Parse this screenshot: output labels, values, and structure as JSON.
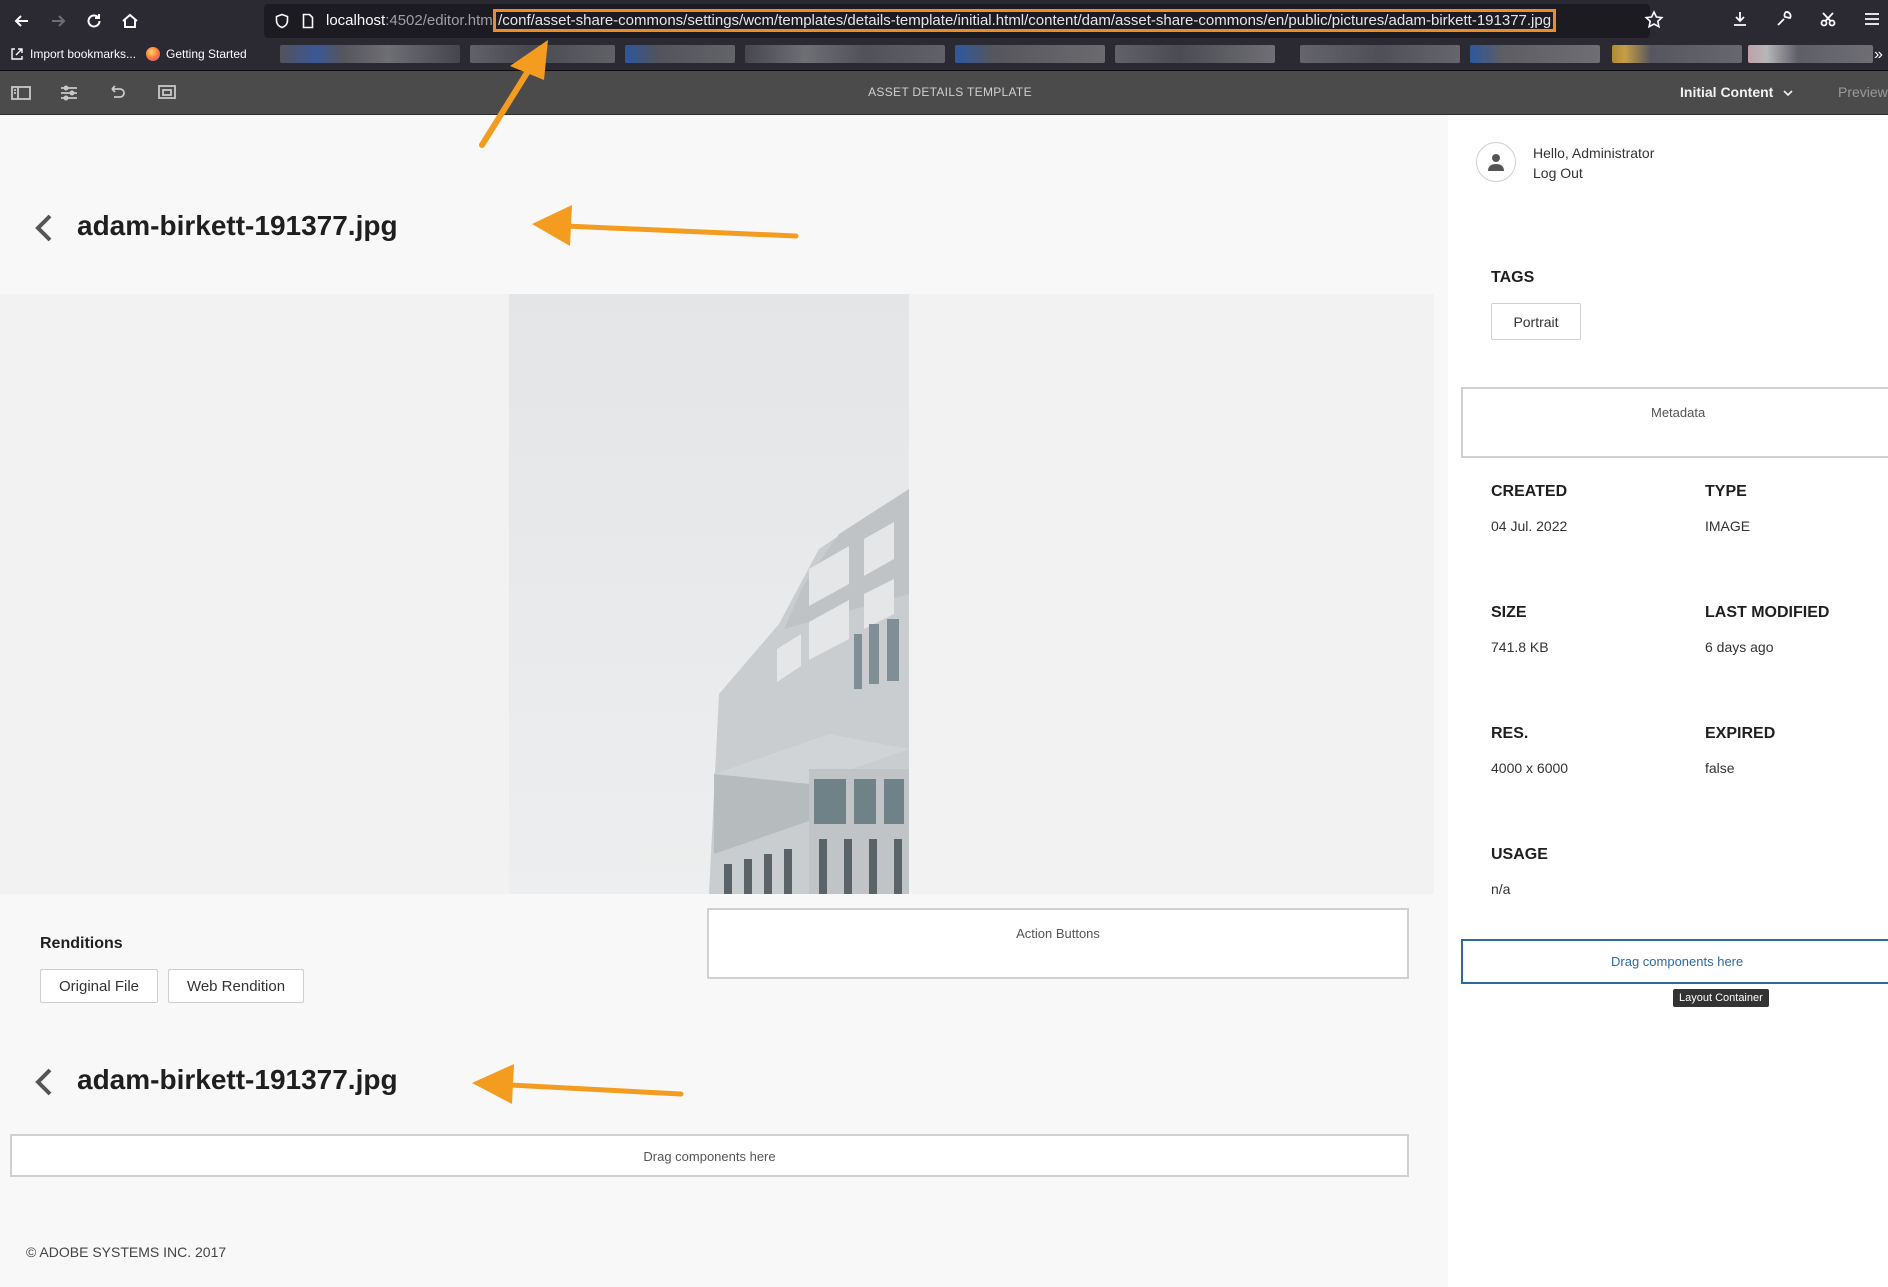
{
  "browser": {
    "url_host": "localhost",
    "url_path_dim": ":4502/editor.html",
    "url_highlighted": "/conf/asset-share-commons/settings/wcm/templates/details-template/initial.html/content/dam/asset-share-commons/en/public/pictures/adam-birkett-191377.jpg",
    "bookmarks": [
      "Import bookmarks...",
      "Getting Started"
    ]
  },
  "editor": {
    "title": "ASSET DETAILS TEMPLATE",
    "mode": "Initial Content",
    "preview": "Preview"
  },
  "page": {
    "title_top": "adam-birkett-191377.jpg",
    "title_bottom": "adam-birkett-191377.jpg",
    "renditions_label": "Renditions",
    "rendition_buttons": [
      "Original File",
      "Web Rendition"
    ],
    "action_buttons_placeholder": "Action Buttons",
    "drag_placeholder": "Drag components here",
    "footer": "© ADOBE SYSTEMS INC. 2017"
  },
  "sidebar": {
    "greeting": "Hello, Administrator",
    "logout": "Log Out",
    "tags_label": "TAGS",
    "tags": [
      "Portrait"
    ],
    "metadata_placeholder": "Metadata",
    "fields": {
      "created_label": "CREATED",
      "created_value": "04 Jul. 2022",
      "type_label": "TYPE",
      "type_value": "IMAGE",
      "size_label": "SIZE",
      "size_value": "741.8 KB",
      "modified_label": "LAST MODIFIED",
      "modified_value": "6 days ago",
      "res_label": "RES.",
      "res_value": "4000 x 6000",
      "expired_label": "EXPIRED",
      "expired_value": "false",
      "usage_label": "USAGE",
      "usage_value": "n/a"
    },
    "drag_placeholder": "Drag components here",
    "tooltip": "Layout Container"
  },
  "colors": {
    "annotation_orange": "#f39c1f",
    "selected_container_border": "#2d6a9f",
    "selected_container_text": "#2d6a9f"
  }
}
